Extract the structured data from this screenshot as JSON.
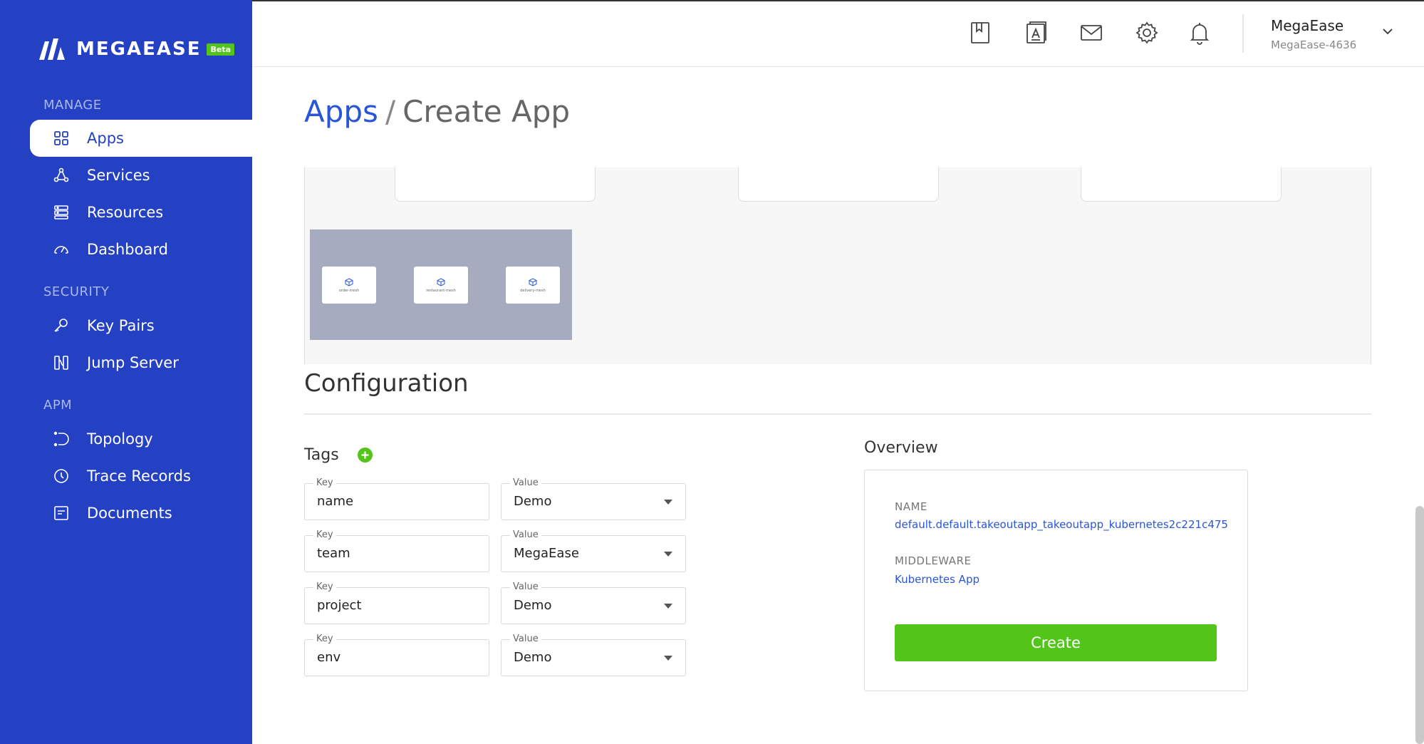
{
  "brand": {
    "name": "MEGAEASE",
    "badge": "Beta",
    "accent": "#2440c3",
    "success": "#52c41a",
    "link": "#2a55d9"
  },
  "sidebar": {
    "sections": [
      {
        "label": "MANAGE"
      },
      {
        "label": "SECURITY"
      },
      {
        "label": "APM"
      }
    ],
    "items": [
      {
        "label": "Apps",
        "icon": "apps-grid-icon",
        "active": true
      },
      {
        "label": "Services",
        "icon": "services-icon"
      },
      {
        "label": "Resources",
        "icon": "resources-icon"
      },
      {
        "label": "Dashboard",
        "icon": "dashboard-gauge-icon"
      },
      {
        "label": "Key Pairs",
        "icon": "key-icon"
      },
      {
        "label": "Jump Server",
        "icon": "jump-server-icon"
      },
      {
        "label": "Topology",
        "icon": "topology-icon"
      },
      {
        "label": "Trace Records",
        "icon": "clock-icon"
      },
      {
        "label": "Documents",
        "icon": "document-icon"
      }
    ]
  },
  "header": {
    "icons": [
      "bookmark-icon",
      "text-document-icon",
      "mail-icon",
      "settings-gear-icon",
      "bell-icon",
      "chevron-down-icon"
    ],
    "user": {
      "name": "MegaEase",
      "account": "MegaEase-4636"
    }
  },
  "breadcrumb": {
    "parent": "Apps",
    "separator": "/",
    "current": "Create App"
  },
  "topology": {
    "mesh_nodes": [
      {
        "label": "order-mesh"
      },
      {
        "label": "restaurant-mesh"
      },
      {
        "label": "delivery-mesh"
      }
    ]
  },
  "configuration": {
    "title": "Configuration",
    "tags_title": "Tags",
    "key_label": "Key",
    "value_label": "Value",
    "tags": [
      {
        "key": "name",
        "value": "Demo"
      },
      {
        "key": "team",
        "value": "MegaEase"
      },
      {
        "key": "project",
        "value": "Demo"
      },
      {
        "key": "env",
        "value": "Demo"
      }
    ]
  },
  "overview": {
    "title": "Overview",
    "name_label": "NAME",
    "name_value": "default.default.takeoutapp_takeoutapp_kubernetes2c221c475",
    "middleware_label": "MIDDLEWARE",
    "middleware_value": "Kubernetes App",
    "create_label": "Create"
  }
}
